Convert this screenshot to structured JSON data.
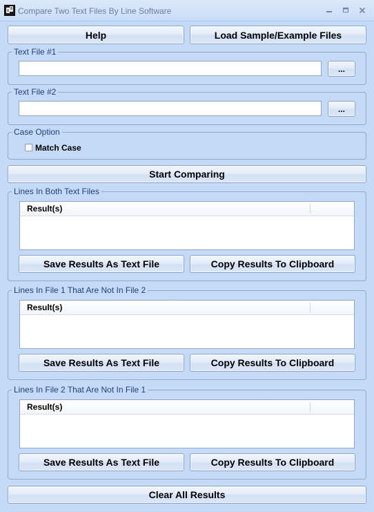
{
  "window": {
    "title": "Compare Two Text Files By Line Software"
  },
  "toolbar": {
    "help_label": "Help",
    "load_sample_label": "Load Sample/Example Files"
  },
  "file1": {
    "legend": "Text File #1",
    "value": "",
    "browse_label": "..."
  },
  "file2": {
    "legend": "Text File #2",
    "value": "",
    "browse_label": "..."
  },
  "case_option": {
    "legend": "Case Option",
    "match_case_label": "Match Case",
    "match_case_checked": false
  },
  "start_label": "Start Comparing",
  "results": [
    {
      "legend": "Lines In Both Text Files",
      "column": "Result(s)",
      "save_label": "Save Results As Text File",
      "copy_label": "Copy Results To Clipboard"
    },
    {
      "legend": "Lines In File 1 That Are Not In File 2",
      "column": "Result(s)",
      "save_label": "Save Results As Text File",
      "copy_label": "Copy Results To Clipboard"
    },
    {
      "legend": "Lines In File 2 That Are Not In File 1",
      "column": "Result(s)",
      "save_label": "Save Results As Text File",
      "copy_label": "Copy Results To Clipboard"
    }
  ],
  "clear_label": "Clear All Results",
  "colors": {
    "background": "#c5daf7",
    "legend_text": "#1e3f7a",
    "border": "#8fa9cd"
  }
}
